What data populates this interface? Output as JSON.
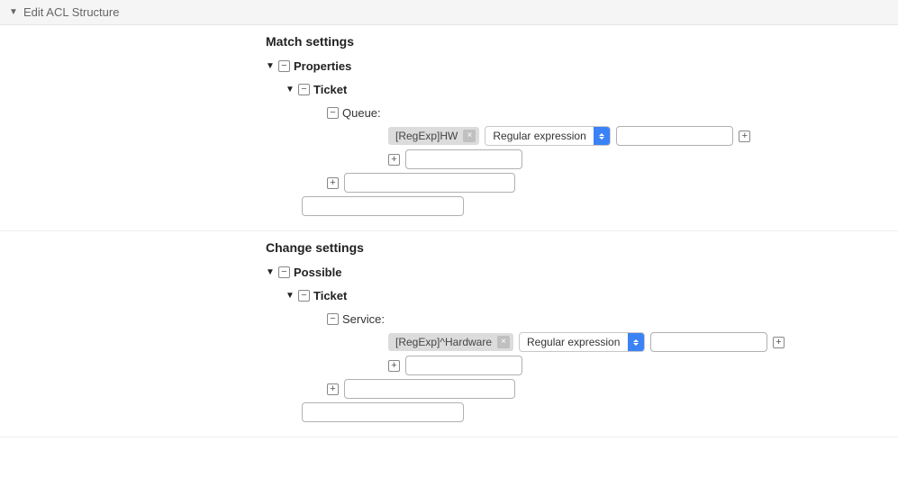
{
  "header": {
    "title": "Edit ACL Structure"
  },
  "match": {
    "title": "Match settings",
    "root_label": "Properties",
    "ticket_label": "Ticket",
    "property_label": "Queue:",
    "tag_text": "[RegExp]HW",
    "select_value": "Regular expression"
  },
  "change": {
    "title": "Change settings",
    "root_label": "Possible",
    "ticket_label": "Ticket",
    "property_label": "Service:",
    "tag_text": "[RegExp]^Hardware",
    "select_value": "Regular expression"
  }
}
